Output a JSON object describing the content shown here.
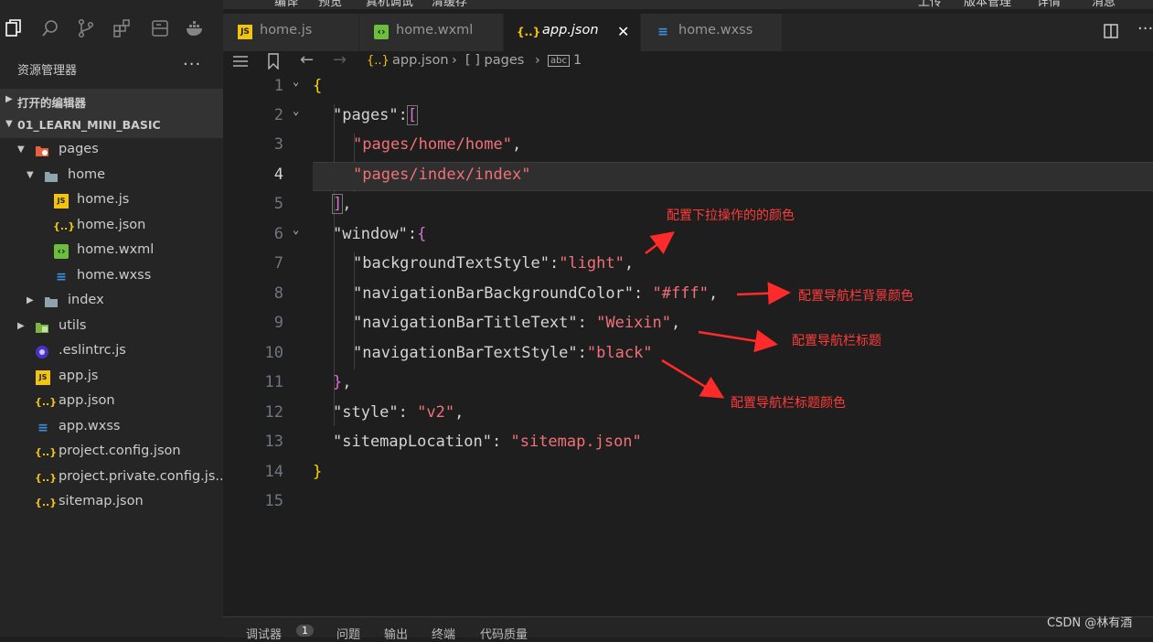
{
  "window_menu": [
    "编译",
    "预览",
    "真机调试",
    "清缓存",
    "上传",
    "版本管理",
    "详情",
    "消息"
  ],
  "explorer": {
    "title": "资源管理器",
    "more": "···",
    "section_open_editors": "打开的编辑器",
    "section_project": "01_LEARN_MINI_BASIC",
    "tree": [
      {
        "name": "pages",
        "icon": "folder-pages-icon",
        "expanded": true
      },
      {
        "name": "home",
        "icon": "folder-open-icon",
        "expanded": true
      },
      {
        "name": "home.js",
        "icon": "js-file-icon"
      },
      {
        "name": "home.json",
        "icon": "json-file-icon"
      },
      {
        "name": "home.wxml",
        "icon": "wxml-file-icon"
      },
      {
        "name": "home.wxss",
        "icon": "wxss-file-icon"
      },
      {
        "name": "index",
        "icon": "folder-icon",
        "expanded": false
      },
      {
        "name": "utils",
        "icon": "folder-utils-icon",
        "expanded": false
      },
      {
        "name": ".eslintrc.js",
        "icon": "eslint-file-icon"
      },
      {
        "name": "app.js",
        "icon": "js-file-icon"
      },
      {
        "name": "app.json",
        "icon": "json-file-icon"
      },
      {
        "name": "app.wxss",
        "icon": "wxss-file-icon"
      },
      {
        "name": "project.config.json",
        "icon": "json-file-icon"
      },
      {
        "name": "project.private.config.js...",
        "icon": "json-file-icon"
      },
      {
        "name": "sitemap.json",
        "icon": "json-file-icon"
      }
    ]
  },
  "tabs": [
    {
      "label": "home.js",
      "icon": "js-file-icon",
      "active": false
    },
    {
      "label": "home.wxml",
      "icon": "wxml-file-icon",
      "active": false
    },
    {
      "label": "app.json",
      "icon": "json-file-icon",
      "active": true,
      "close": "✕"
    },
    {
      "label": "home.wxss",
      "icon": "wxss-file-icon",
      "active": false
    }
  ],
  "breadcrumb": {
    "file": "app.json",
    "path1": "[ ] pages",
    "path2": "1"
  },
  "code": {
    "line_numbers": [
      "1",
      "2",
      "3",
      "4",
      "5",
      "6",
      "7",
      "8",
      "9",
      "10",
      "11",
      "12",
      "13",
      "14",
      "15"
    ],
    "current_line": "4"
  },
  "annotations": {
    "a1": "配置下拉操作的的颜色",
    "a2": "配置导航栏背景颜色",
    "a3": "配置导航栏标题",
    "a4": "配置导航栏标题颜色"
  },
  "bottom_panel": {
    "debugger": "调试器",
    "debugger_count": "1",
    "problems": "问题",
    "output": "输出",
    "terminal": "终端",
    "code_quality": "代码质量"
  },
  "watermark": "CSDN @林有酒",
  "colors": {
    "string": "#f07178",
    "brace": "#ffd700",
    "bracket": "#da70d6",
    "annotation": "#ff3b3b"
  }
}
